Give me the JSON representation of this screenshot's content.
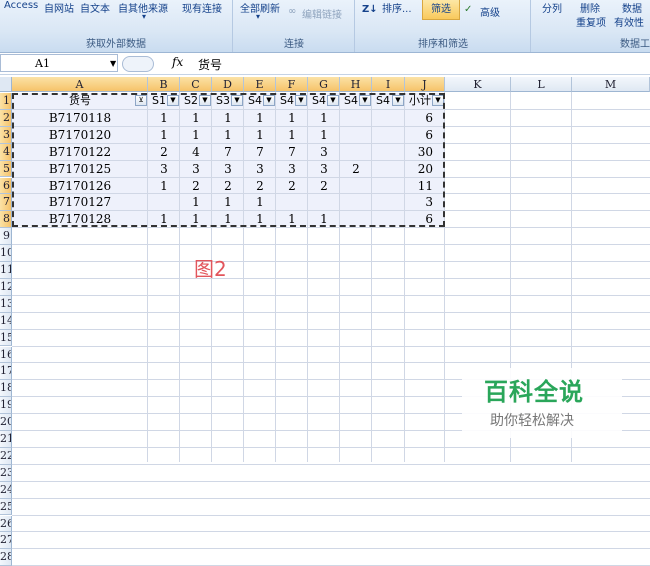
{
  "ribbon": {
    "external": {
      "buttons": [
        "Access",
        "自网站",
        "自文本",
        "自其他来源",
        "现有连接"
      ],
      "group_label": "获取外部数据"
    },
    "connections": {
      "refresh_all": "全部刷新",
      "edit_links": "编辑链接",
      "group_label": "连接"
    },
    "sort_filter": {
      "sort": "排序...",
      "filter": "筛选",
      "advanced": "高级",
      "group_label": "排序和筛选"
    },
    "data_tools": {
      "text_to_columns": "分列",
      "remove_duplicates_1": "删除",
      "remove_duplicates_2": "重复项",
      "validation_1": "数据",
      "validation_2": "有效性",
      "group_label": "数据工"
    }
  },
  "formula_bar": {
    "name_box": "A1",
    "fx": "fx",
    "value": "货号"
  },
  "columns": [
    "A",
    "B",
    "C",
    "D",
    "E",
    "F",
    "G",
    "H",
    "I",
    "J",
    "K",
    "L",
    "M"
  ],
  "rows": [
    "1",
    "2",
    "3",
    "4",
    "5",
    "6",
    "7",
    "8",
    "9",
    "10",
    "11",
    "12",
    "13",
    "14",
    "15",
    "16",
    "17",
    "18",
    "19",
    "20",
    "21",
    "22",
    "23",
    "24",
    "25",
    "26",
    "27",
    "28"
  ],
  "table": {
    "headers": [
      "货号",
      "S1",
      "S2",
      "S3",
      "S4",
      "S4",
      "S4",
      "S4",
      "S4",
      "小计"
    ],
    "rows": [
      [
        "B7170118",
        "1",
        "1",
        "1",
        "1",
        "1",
        "1",
        "",
        "",
        "6"
      ],
      [
        "B7170120",
        "1",
        "1",
        "1",
        "1",
        "1",
        "1",
        "",
        "",
        "6"
      ],
      [
        "B7170122",
        "2",
        "4",
        "7",
        "7",
        "7",
        "3",
        "",
        "",
        "30"
      ],
      [
        "B7170125",
        "3",
        "3",
        "3",
        "3",
        "3",
        "3",
        "2",
        "",
        "20"
      ],
      [
        "B7170126",
        "1",
        "2",
        "2",
        "2",
        "2",
        "2",
        "",
        "",
        "11"
      ],
      [
        "B7170127",
        "",
        "1",
        "1",
        "1",
        "",
        "",
        "",
        "",
        "3"
      ],
      [
        "B7170128",
        "1",
        "1",
        "1",
        "1",
        "1",
        "1",
        "",
        "",
        "6"
      ]
    ]
  },
  "caption": "图2",
  "watermark": {
    "title": "百科全说",
    "subtitle": "助你轻松解决"
  },
  "colors": {
    "selected_header": "#f6c36a",
    "table_fill": "#eef1fb",
    "caption": "#e2555c",
    "watermark": "#2aa65a"
  }
}
